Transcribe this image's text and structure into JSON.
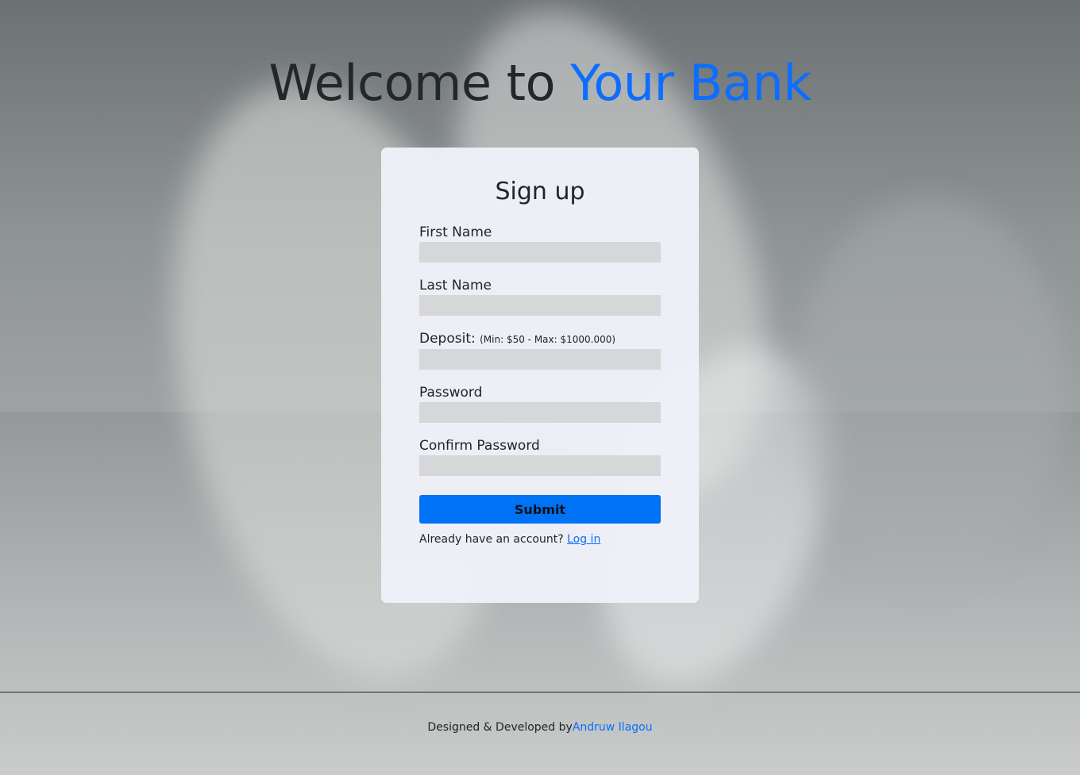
{
  "header": {
    "title_prefix": "Welcome to ",
    "title_accent": "Your Bank"
  },
  "form": {
    "title": "Sign up",
    "fields": [
      {
        "label": "First Name",
        "value": ""
      },
      {
        "label": "Last Name",
        "value": ""
      },
      {
        "label": "Deposit:",
        "hint": "(Min: $50 - Max: $1000.000)",
        "value": ""
      },
      {
        "label": "Password",
        "value": ""
      },
      {
        "label": "Confirm Password",
        "value": ""
      }
    ],
    "submit_label": "Submit",
    "login_prompt": "Already have an account?",
    "login_link": "Log in"
  },
  "footer": {
    "text": "Designed & Developed by",
    "author": "Andruw Ilagou"
  },
  "colors": {
    "accent": "#0d6efd",
    "button": "#0072f5"
  }
}
